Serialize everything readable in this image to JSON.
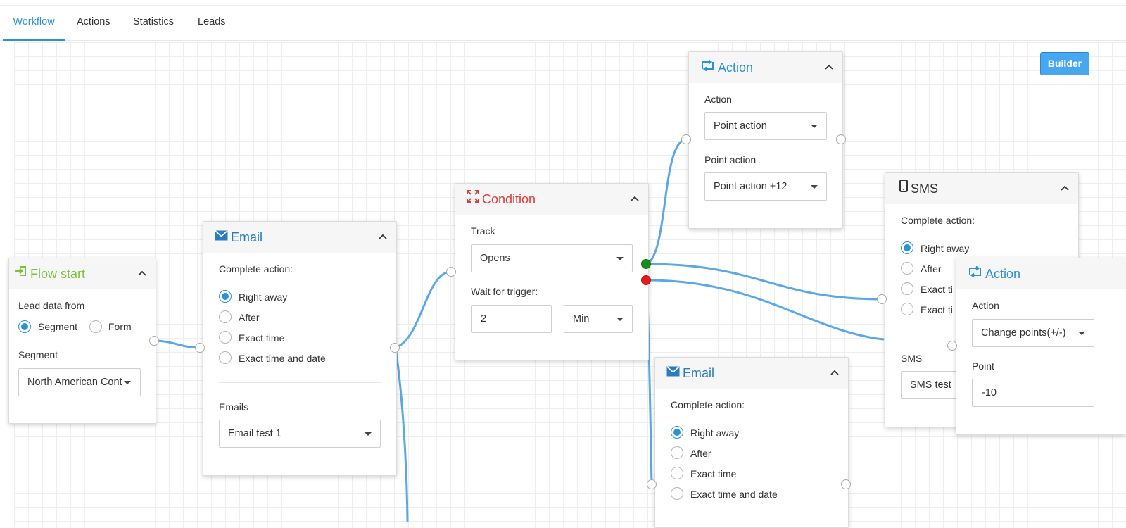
{
  "tabs": [
    {
      "label": "Workflow",
      "active": true
    },
    {
      "label": "Actions"
    },
    {
      "label": "Statistics"
    },
    {
      "label": "Leads"
    }
  ],
  "builder_label": "Builder",
  "colors": {
    "accent": "#2a92d6",
    "flow_start": "#7cc23a",
    "condition": "#e23b3b",
    "wire": "#5aa8e6",
    "yes_port": "#1a8a1a",
    "no_port": "#e41b1b"
  },
  "nodes": {
    "flow_start": {
      "title": "Flow start",
      "icon": "enter-icon",
      "lead_label": "Lead data from",
      "options": [
        "Segment",
        "Form"
      ],
      "selected": "Segment",
      "segment_label": "Segment",
      "segment_value": "North American Cont"
    },
    "email1": {
      "title": "Email",
      "icon": "envelope-icon",
      "complete_label": "Complete action:",
      "options": [
        "Right away",
        "After",
        "Exact time",
        "Exact time and date"
      ],
      "selected": "Right away",
      "emails_label": "Emails",
      "emails_value": "Email test 1"
    },
    "condition": {
      "title": "Condition",
      "icon": "expand-arrows-icon",
      "track_label": "Track",
      "track_value": "Opens",
      "wait_label": "Wait for trigger:",
      "wait_value": "2",
      "wait_unit": "Min"
    },
    "action1": {
      "title": "Action",
      "icon": "repeat-icon",
      "action_label": "Action",
      "action_value": "Point action",
      "point_label": "Point action",
      "point_value": "Point action +12"
    },
    "email2": {
      "title": "Email",
      "icon": "envelope-icon",
      "complete_label": "Complete action:",
      "options": [
        "Right away",
        "After",
        "Exact time",
        "Exact time and date"
      ],
      "selected": "Right away"
    },
    "sms": {
      "title": "SMS",
      "icon": "mobile-phone-icon",
      "complete_label": "Complete action:",
      "options": [
        "Right away",
        "After",
        "Exact ti",
        "Exact ti"
      ],
      "selected": "Right away",
      "sms_label": "SMS",
      "sms_value": "SMS test"
    },
    "action2": {
      "title": "Action",
      "icon": "repeat-icon",
      "action_label": "Action",
      "action_value": "Change points(+/-)",
      "point_label": "Point",
      "point_value": "-10"
    }
  }
}
